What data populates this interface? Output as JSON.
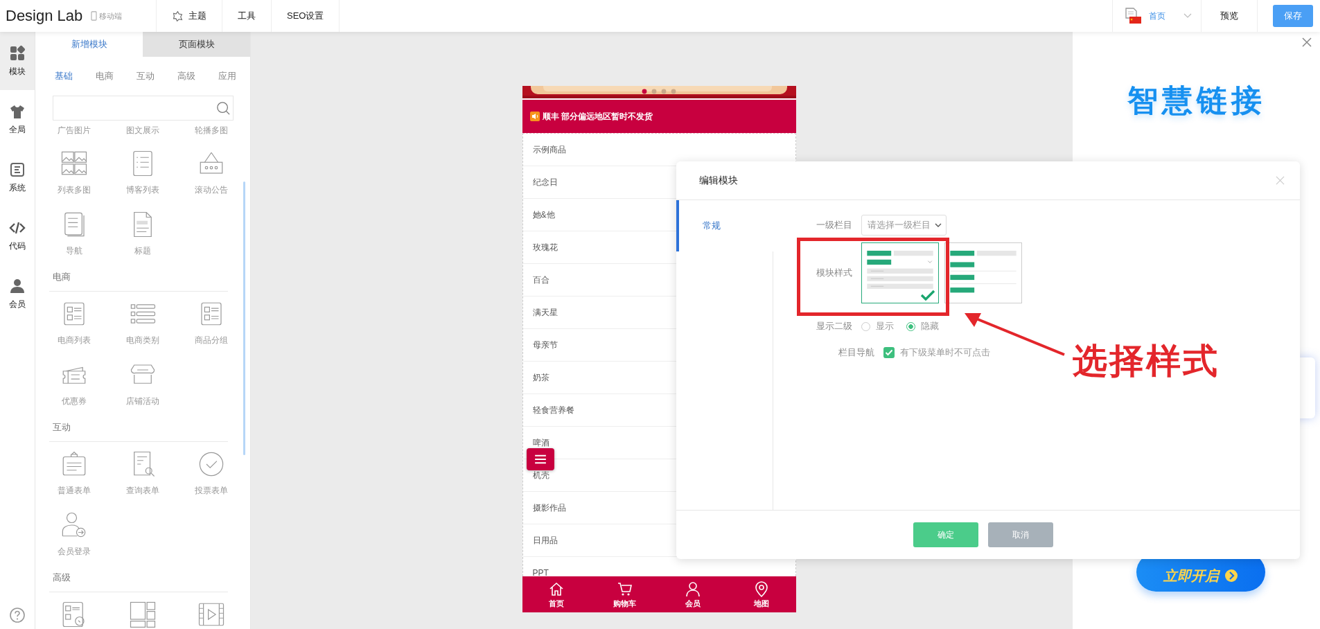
{
  "topbar": {
    "logo": "Design Lab",
    "device": "移动端",
    "device_selected": false,
    "menu": [
      {
        "label": "主题"
      },
      {
        "label": "工具"
      },
      {
        "label": "SEO设置"
      }
    ],
    "page_select": "首页",
    "preview": "预览",
    "save": "保存"
  },
  "rail": [
    {
      "label": "模块",
      "selected": true
    },
    {
      "label": "全局",
      "selected": false
    },
    {
      "label": "系统",
      "selected": false
    },
    {
      "label": "代码",
      "selected": false
    },
    {
      "label": "会员",
      "selected": false
    }
  ],
  "panel": {
    "tabs": [
      {
        "label": "新增模块",
        "selected": true
      },
      {
        "label": "页面模块",
        "selected": false
      }
    ],
    "categories": [
      {
        "label": "基础",
        "selected": true
      },
      {
        "label": "电商",
        "selected": false
      },
      {
        "label": "互动",
        "selected": false
      },
      {
        "label": "高级",
        "selected": false
      },
      {
        "label": "应用",
        "selected": false
      }
    ],
    "sections": [
      {
        "items": [
          {
            "kind": "label-only",
            "label": "广告图片"
          },
          {
            "kind": "label-only",
            "label": "图文展示"
          },
          {
            "kind": "label-only",
            "label": "轮播多图"
          },
          {
            "kind": "tile",
            "label": "列表多图"
          },
          {
            "kind": "tile",
            "label": "博客列表"
          },
          {
            "kind": "tile",
            "label": "滚动公告"
          },
          {
            "kind": "tile",
            "label": "导航"
          },
          {
            "kind": "tile",
            "label": "标题"
          }
        ]
      },
      {
        "title": "电商",
        "items": [
          {
            "kind": "tile",
            "label": "电商列表"
          },
          {
            "kind": "tile",
            "label": "电商类别"
          },
          {
            "kind": "tile",
            "label": "商品分组"
          },
          {
            "kind": "tile",
            "label": "优惠券"
          },
          {
            "kind": "tile",
            "label": "店铺活动"
          }
        ]
      },
      {
        "title": "互动",
        "items": [
          {
            "kind": "tile",
            "label": "普通表单"
          },
          {
            "kind": "tile",
            "label": "查询表单"
          },
          {
            "kind": "tile",
            "label": "投票表单"
          },
          {
            "kind": "tile",
            "label": "会员登录"
          }
        ]
      },
      {
        "title": "高级",
        "items": [
          {
            "kind": "icon-only"
          },
          {
            "kind": "icon-only"
          },
          {
            "kind": "icon-only"
          }
        ]
      }
    ]
  },
  "phone": {
    "notice": "顺丰 部分偏远地区暂时不发货",
    "items": [
      "示例商品",
      "纪念日",
      "她&他",
      "玫瑰花",
      "百合",
      "满天星",
      "母亲节",
      "奶茶",
      "轻食营养餐",
      "啤酒",
      "机壳",
      "摄影作品",
      "日用品",
      "PPT"
    ],
    "nav": [
      {
        "label": "首页"
      },
      {
        "label": "购物车"
      },
      {
        "label": "会员"
      },
      {
        "label": "地图"
      }
    ]
  },
  "dialog": {
    "title": "编辑模块",
    "tabs": [
      {
        "label": "常规",
        "selected": true
      }
    ],
    "level1_label": "一级栏目",
    "level1_placeholder": "请选择一级栏目",
    "style_label": "模块样式",
    "styles": [
      {
        "kind": "dropdown",
        "selected": true
      },
      {
        "kind": "list",
        "selected": false
      }
    ],
    "second_label": "显示二级",
    "second_options": [
      {
        "label": "显示",
        "selected": false
      },
      {
        "label": "隐藏",
        "selected": true
      }
    ],
    "nav_label": "栏目导航",
    "nav_checkbox": {
      "label": "有下级菜单时不可点击",
      "checked": true
    },
    "confirm": "确定",
    "cancel": "取消"
  },
  "annotation": {
    "text": "选择样式"
  },
  "promo": {
    "title": "智慧链接",
    "button": "立即开启"
  }
}
